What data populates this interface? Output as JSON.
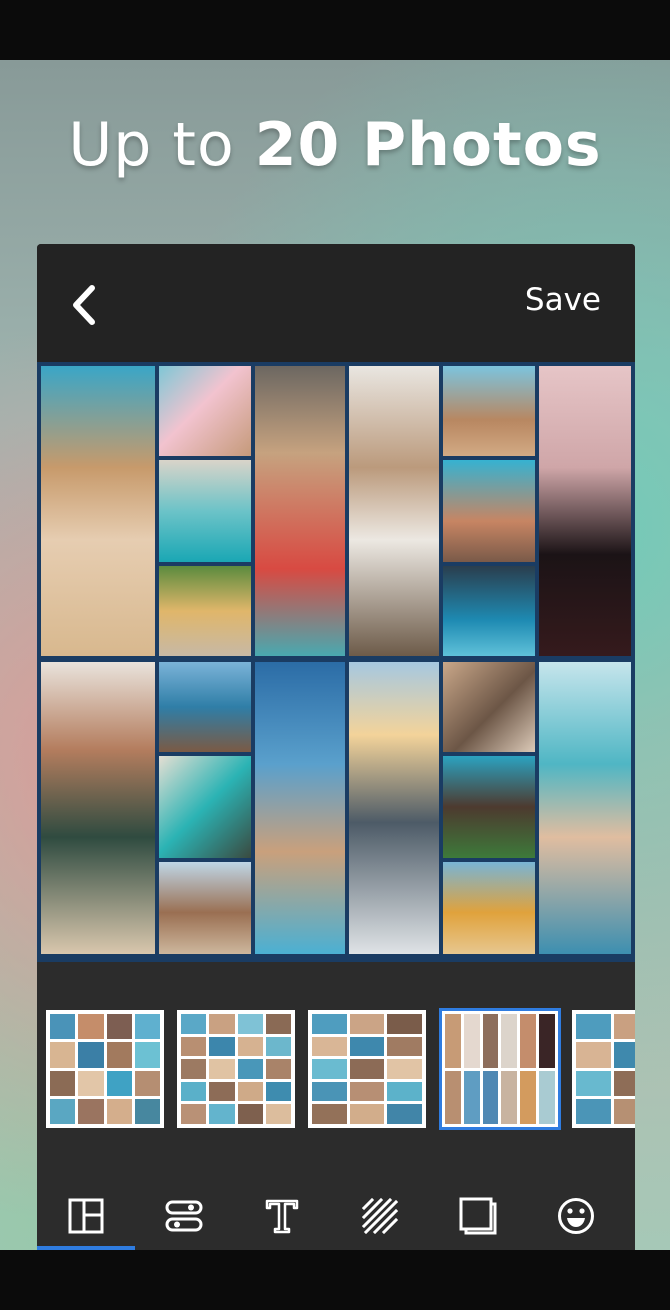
{
  "headline": {
    "light": "Up to ",
    "bold": "20 Photos"
  },
  "app": {
    "save_label": "Save",
    "back_icon": "chevron-left-icon"
  },
  "colors": {
    "accent": "#2f7ce0",
    "panel": "#2c2c2c",
    "header": "#232323",
    "collage_border": "#1a3c63"
  },
  "layout_thumbnails": [
    {
      "name": "layout-grid-4x4",
      "selected": false
    },
    {
      "name": "layout-grid-5x4",
      "selected": false
    },
    {
      "name": "layout-rows-mixed",
      "selected": false
    },
    {
      "name": "layout-columns-6",
      "selected": true
    },
    {
      "name": "layout-grid-partial",
      "selected": false
    }
  ],
  "toolbar": [
    {
      "name": "layout-tool",
      "icon": "layout-icon",
      "active": true
    },
    {
      "name": "spacing-tool",
      "icon": "spacing-icon",
      "active": false
    },
    {
      "name": "text-tool",
      "icon": "text-icon",
      "active": false
    },
    {
      "name": "pattern-tool",
      "icon": "pattern-icon",
      "active": false
    },
    {
      "name": "border-tool",
      "icon": "border-icon",
      "active": false
    },
    {
      "name": "sticker-tool",
      "icon": "smiley-icon",
      "active": false
    }
  ]
}
